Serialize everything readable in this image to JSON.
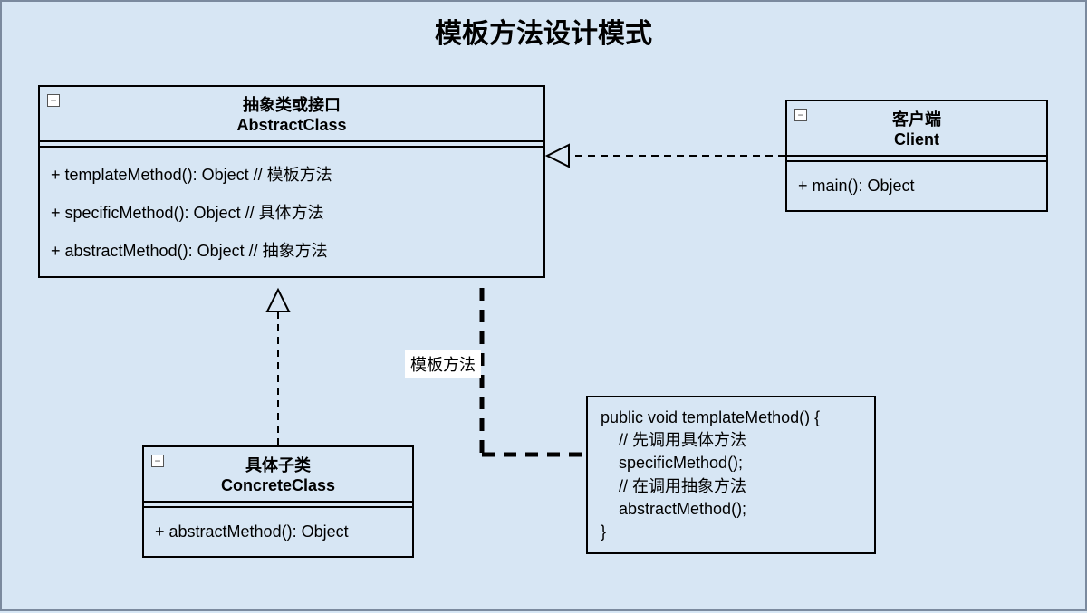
{
  "title": "模板方法设计模式",
  "abstractClass": {
    "sub": "抽象类或接口",
    "main": "AbstractClass",
    "methods": [
      "+ templateMethod(): Object   // 模板方法",
      "+ specificMethod(): Object   // 具体方法",
      "+ abstractMethod(): Object  // 抽象方法"
    ]
  },
  "client": {
    "sub": "客户端",
    "main": "Client",
    "methods": [
      "+ main(): Object"
    ]
  },
  "concreteClass": {
    "sub": "具体子类",
    "main": "ConcreteClass",
    "methods": [
      "+ abstractMethod(): Object"
    ]
  },
  "label": "模板方法",
  "code": "public void templateMethod() {\n    // 先调用具体方法\n    specificMethod();\n    // 在调用抽象方法\n    abstractMethod();\n}",
  "collapseIcon": "−"
}
